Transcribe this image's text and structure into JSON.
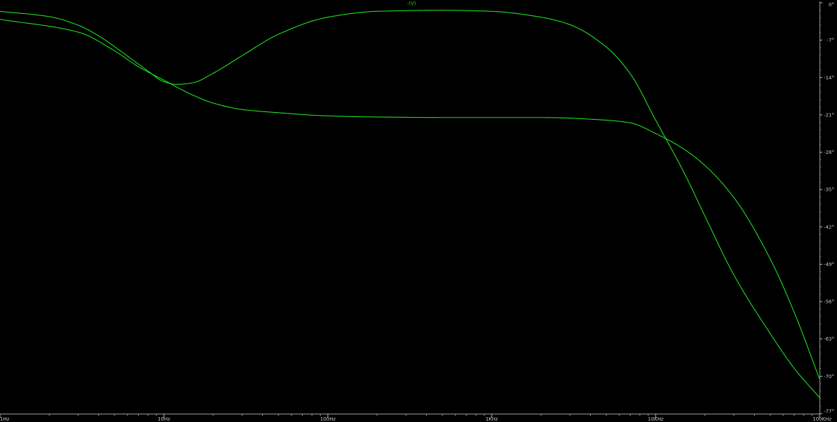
{
  "chart_data": {
    "type": "line",
    "title": "-(V)",
    "x_scale": "log",
    "xlim": [
      1,
      100000
    ],
    "ylim": [
      -77,
      0
    ],
    "x_ticks": [
      {
        "value": 1,
        "label": "1Hz"
      },
      {
        "value": 10,
        "label": "10Hz"
      },
      {
        "value": 100,
        "label": "100Hz"
      },
      {
        "value": 1000,
        "label": "1KHz"
      },
      {
        "value": 10000,
        "label": "10KHz"
      },
      {
        "value": 100000,
        "label": "100KHz"
      }
    ],
    "y_ticks": [
      {
        "value": 0,
        "label": "0°"
      },
      {
        "value": -7,
        "label": "-7°"
      },
      {
        "value": -14,
        "label": "-14°"
      },
      {
        "value": -21,
        "label": "-21°"
      },
      {
        "value": -28,
        "label": "-28°"
      },
      {
        "value": -35,
        "label": "-35°"
      },
      {
        "value": -42,
        "label": "-42°"
      },
      {
        "value": -49,
        "label": "-49°"
      },
      {
        "value": -56,
        "label": "-56°"
      },
      {
        "value": -63,
        "label": "-63°"
      },
      {
        "value": -70,
        "label": "-70°"
      },
      {
        "value": -77,
        "label": "-77°"
      }
    ],
    "grid": false,
    "series": [
      {
        "color": "#1fe01f",
        "x": [
          1,
          2,
          3,
          4,
          6,
          8,
          10,
          12,
          15,
          20,
          30,
          50,
          100,
          200,
          500,
          1000,
          2000,
          3000,
          5000,
          7000,
          10000,
          15000,
          20000,
          30000,
          50000,
          70000,
          100000
        ],
        "y": [
          -1.6,
          -2.6,
          -4.2,
          -6.2,
          -10.0,
          -12.8,
          -14.8,
          -15.3,
          -15.0,
          -13.2,
          -9.9,
          -5.9,
          -2.7,
          -1.6,
          -1.4,
          -1.6,
          -2.7,
          -4.1,
          -8.3,
          -13.3,
          -22.0,
          -32.0,
          -40.0,
          -51.0,
          -62.0,
          -68.5,
          -74.0
        ]
      },
      {
        "color": "#1fe01f",
        "x": [
          1,
          3,
          5,
          7,
          10,
          15,
          20,
          30,
          50,
          100,
          200,
          500,
          1000,
          2000,
          5000,
          7000,
          10000,
          15000,
          20000,
          30000,
          50000,
          70000,
          100000
        ],
        "y": [
          -3.1,
          -5.5,
          -9.0,
          -12.0,
          -14.5,
          -17.3,
          -18.8,
          -20.0,
          -20.6,
          -21.2,
          -21.4,
          -21.5,
          -21.5,
          -21.5,
          -22.0,
          -22.5,
          -24.5,
          -27.5,
          -30.5,
          -36.5,
          -48.0,
          -58.0,
          -70.5
        ]
      }
    ]
  }
}
